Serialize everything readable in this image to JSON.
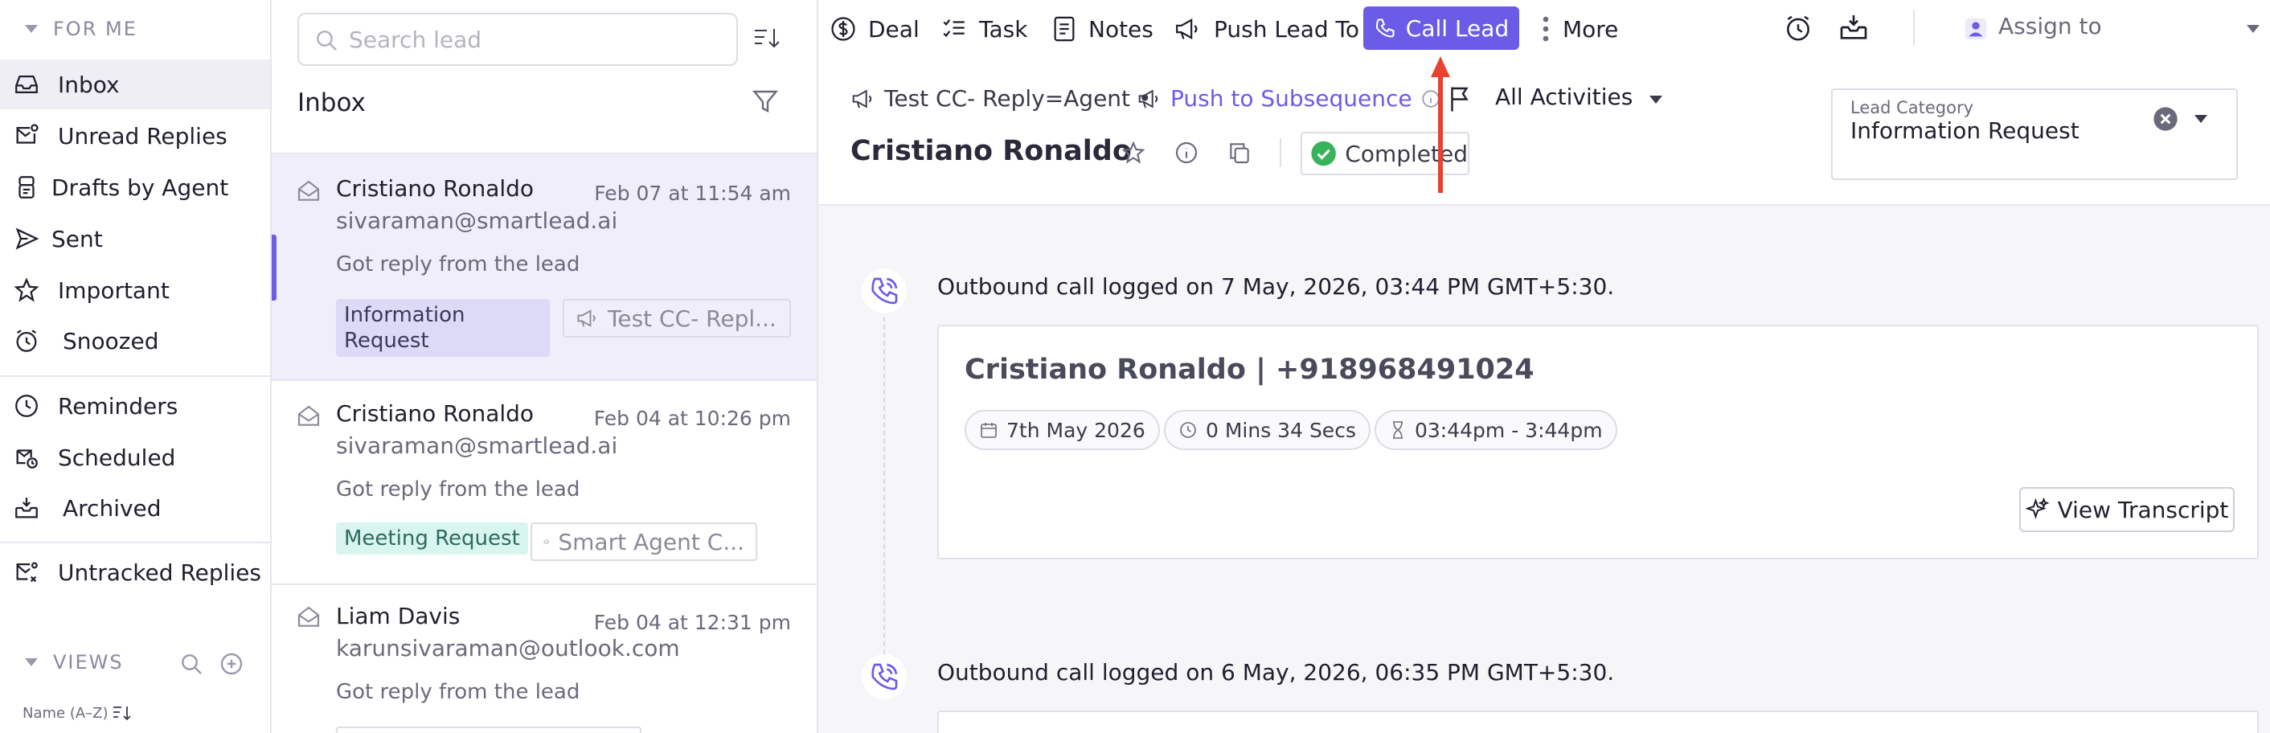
{
  "sidebar": {
    "for_me_heading": "FOR ME",
    "items": [
      {
        "label": "Inbox",
        "icon": "inbox-icon"
      },
      {
        "label": "Unread Replies",
        "icon": "unread-icon"
      },
      {
        "label": "Drafts by Agent",
        "icon": "drafts-icon"
      },
      {
        "label": "Sent",
        "icon": "send-icon"
      },
      {
        "label": "Important",
        "icon": "star-icon"
      },
      {
        "label": "Snoozed",
        "icon": "clock-icon"
      },
      {
        "label": "Reminders",
        "icon": "reminder-icon"
      },
      {
        "label": "Scheduled",
        "icon": "scheduled-icon"
      },
      {
        "label": "Archived",
        "icon": "archive-icon"
      },
      {
        "label": "Untracked Replies",
        "icon": "untracked-icon"
      }
    ],
    "views_heading": "VIEWS",
    "sort_label": "Name (A–Z)"
  },
  "list": {
    "search_placeholder": "Search lead",
    "title": "Inbox",
    "leads": [
      {
        "name": "Cristiano Ronaldo",
        "email": "sivaraman@smartlead.ai",
        "date": "Feb 07 at 11:54 am",
        "snippet": "Got reply from the lead",
        "tag": "Information Request",
        "campaign": "Test CC- Repl..."
      },
      {
        "name": "Cristiano Ronaldo",
        "email": "sivaraman@smartlead.ai",
        "date": "Feb 04 at 10:26 pm",
        "snippet": "Got reply from the lead",
        "tag": "Meeting Request",
        "campaign": "Smart Agent C..."
      },
      {
        "name": "Liam Davis",
        "email": "karunsivaraman@outlook.com",
        "date": "Feb 04 at 12:31 pm",
        "snippet": "Got reply from the lead"
      }
    ]
  },
  "toolbar": {
    "deal": "Deal",
    "task": "Task",
    "notes": "Notes",
    "push_lead": "Push Lead To",
    "call_lead": "Call Lead",
    "more": "More",
    "assign": "Assign to"
  },
  "header": {
    "campaign": "Test CC- Reply=Agent",
    "push_subsequence": "Push to Subsequence",
    "activities": "All Activities",
    "lead_name": "Cristiano Ronaldo",
    "status": "Completed",
    "category_label": "Lead Category",
    "category_value": "Information Request"
  },
  "timeline": [
    {
      "text": "Outbound call logged on 7 May, 2026, 03:44 PM GMT+5:30.",
      "title": "Cristiano Ronaldo | +918968491024",
      "date": "7th May 2026",
      "duration": "0 Mins 34 Secs",
      "time_range": "03:44pm - 3:44pm",
      "transcript_button": "View Transcript"
    },
    {
      "text": "Outbound call logged on 6 May, 2026, 06:35 PM GMT+5:30."
    }
  ],
  "colors": {
    "accent": "#6c5ce7",
    "call_button": "#6b5ce7",
    "arrow": "#e8432e",
    "info_tag": "#dcdaf6",
    "meeting_tag": "#d8f5ef"
  }
}
